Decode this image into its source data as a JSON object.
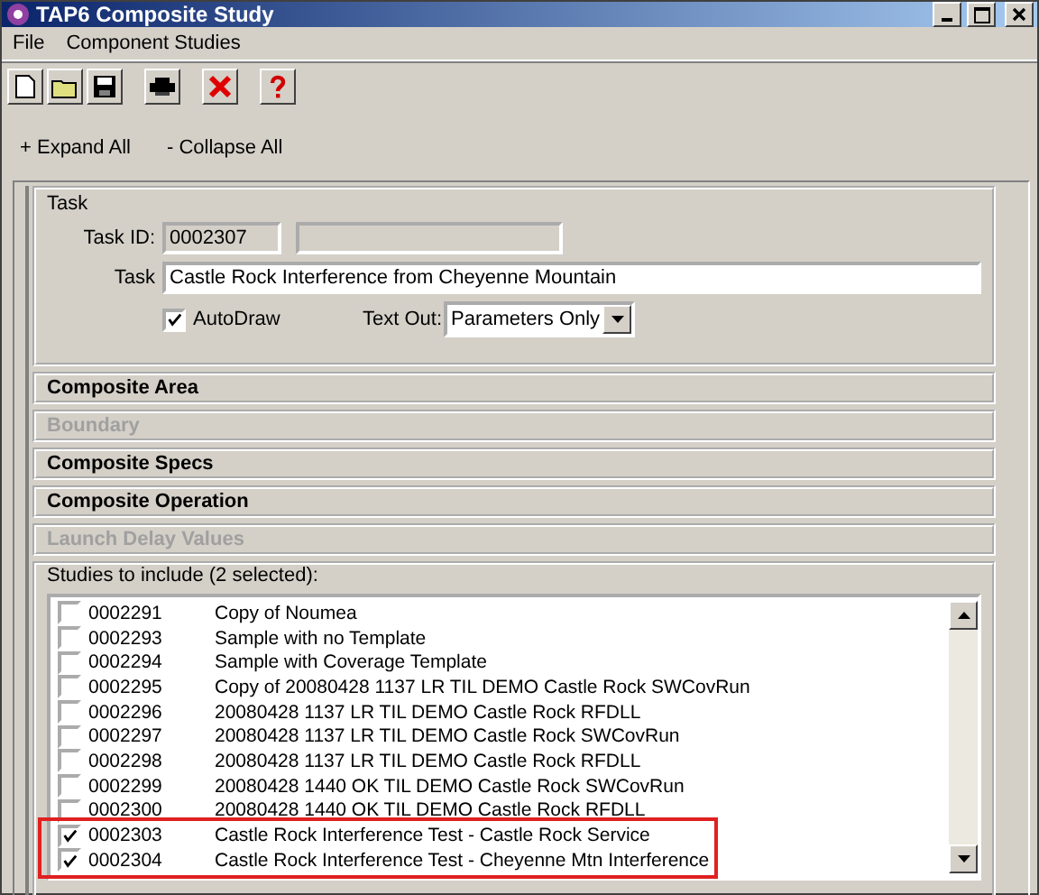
{
  "window": {
    "title": "TAP6 Composite Study"
  },
  "menu": [
    "File",
    "Component Studies"
  ],
  "expand_links": [
    "+ Expand All",
    "- Collapse All"
  ],
  "task": {
    "heading": "Task",
    "id_label": "Task ID:",
    "id_value": "0002307",
    "name_label": "Task",
    "name_value": "Castle Rock Interference from Cheyenne Mountain",
    "autodraw": {
      "label": "AutoDraw",
      "checked": true
    },
    "text_out": {
      "label": "Text Out:",
      "value": "Parameters Only"
    }
  },
  "sections": [
    {
      "label": "Composite Area",
      "disabled": false
    },
    {
      "label": "Boundary",
      "disabled": true
    },
    {
      "label": "Composite Specs",
      "disabled": false
    },
    {
      "label": "Composite Operation",
      "disabled": false
    },
    {
      "label": "Launch Delay Values",
      "disabled": true
    }
  ],
  "studies": {
    "label": "Studies to include (2 selected):",
    "rows": [
      {
        "id": "0002291",
        "name": "Copy of Noumea",
        "checked": false,
        "highlighted": false
      },
      {
        "id": "0002293",
        "name": "Sample with no Template",
        "checked": false,
        "highlighted": false
      },
      {
        "id": "0002294",
        "name": "Sample with Coverage Template",
        "checked": false,
        "highlighted": false
      },
      {
        "id": "0002295",
        "name": "Copy of 20080428 1137 LR TIL DEMO Castle Rock SWCovRun",
        "checked": false,
        "highlighted": false
      },
      {
        "id": "0002296",
        "name": "20080428 1137 LR TIL DEMO Castle Rock RFDLL",
        "checked": false,
        "highlighted": false
      },
      {
        "id": "0002297",
        "name": "20080428 1137 LR TIL DEMO Castle Rock SWCovRun",
        "checked": false,
        "highlighted": false
      },
      {
        "id": "0002298",
        "name": "20080428 1137 LR TIL DEMO Castle Rock RFDLL",
        "checked": false,
        "highlighted": false
      },
      {
        "id": "0002299",
        "name": "20080428 1440 OK TIL DEMO Castle Rock SWCovRun",
        "checked": false,
        "highlighted": false
      },
      {
        "id": "0002300",
        "name": "20080428 1440 OK TIL DEMO Castle Rock RFDLL",
        "checked": false,
        "highlighted": false
      },
      {
        "id": "0002303",
        "name": "Castle Rock Interference Test - Castle Rock Service",
        "checked": true,
        "highlighted": true
      },
      {
        "id": "0002304",
        "name": "Castle Rock Interference Test - Cheyenne Mtn Interference",
        "checked": true,
        "highlighted": true
      }
    ]
  }
}
